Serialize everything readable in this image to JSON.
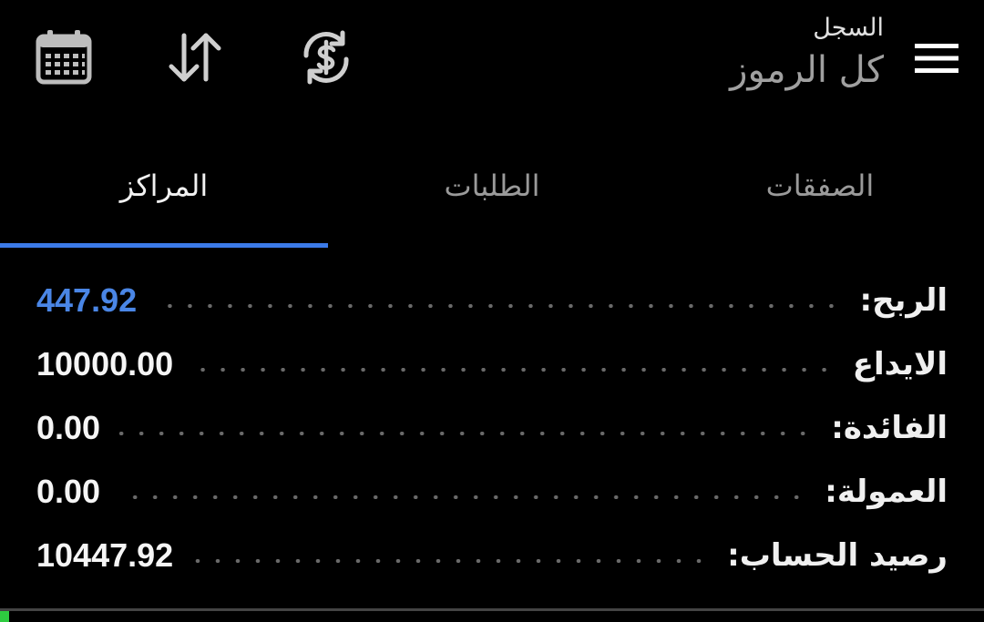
{
  "header": {
    "subtitle": "السجل",
    "title": "كل الرموز",
    "icons": {
      "menu": "menu-icon",
      "exchange": "currency-exchange-icon",
      "sort": "sort-arrows-icon",
      "calendar": "calendar-icon"
    }
  },
  "tabs": [
    {
      "label": "الصفقات",
      "active": false
    },
    {
      "label": "الطلبات",
      "active": false
    },
    {
      "label": "المراكز",
      "active": true
    }
  ],
  "summary": [
    {
      "label": "الربح:",
      "value": "447.92",
      "accent": true
    },
    {
      "label": "الايداع",
      "value": "10000.00",
      "accent": false
    },
    {
      "label": "الفائدة:",
      "value": "0.00",
      "accent": false
    },
    {
      "label": "العمولة:",
      "value": "0.00",
      "accent": false
    },
    {
      "label": "رصيد الحساب:",
      "value": "10447.92",
      "accent": false
    }
  ],
  "colors": {
    "background": "#000000",
    "accent": "#3b7ae8",
    "profit": "#4a86e6",
    "text": "#f0f0f0",
    "muted": "#9a9a9a"
  }
}
